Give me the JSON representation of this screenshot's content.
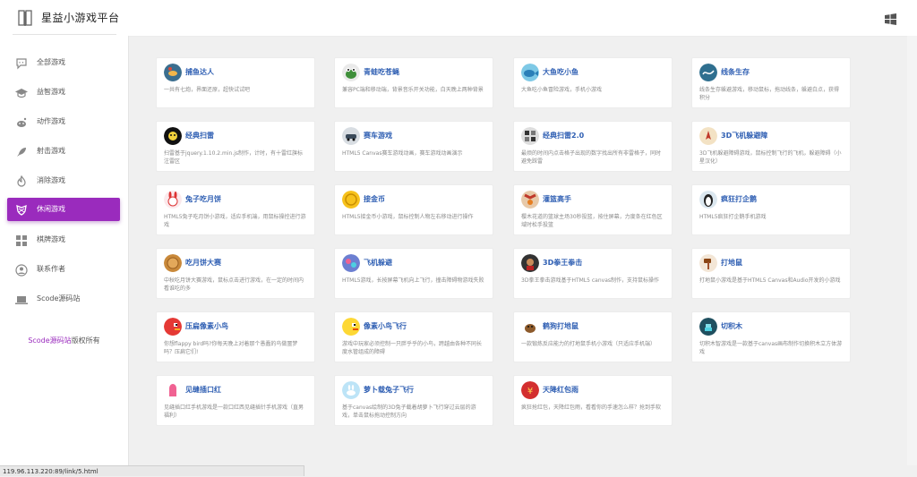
{
  "header": {
    "brand": "星益小游戏平台",
    "logo_icon": "book-logo-icon",
    "windows_icon": "windows-logo-icon"
  },
  "sidebar": {
    "accent_color": "#9a2bbd",
    "items": [
      {
        "label": "全部游戏",
        "icon": "chat-bubble-icon"
      },
      {
        "label": "益智游戏",
        "icon": "graduation-cap-icon"
      },
      {
        "label": "动作游戏",
        "icon": "reddit-icon"
      },
      {
        "label": "射击游戏",
        "icon": "rocket-icon"
      },
      {
        "label": "消除游戏",
        "icon": "fire-icon"
      },
      {
        "label": "休闲游戏",
        "icon": "shield-icon"
      },
      {
        "label": "棋牌游戏",
        "icon": "grid-icon"
      },
      {
        "label": "联系作者",
        "icon": "user-icon"
      },
      {
        "label": "Scode源码站",
        "icon": "laptop-icon"
      }
    ],
    "active_index": 5,
    "copyright_link": "Scode源码站",
    "copyright_suffix": "版权所有"
  },
  "games": [
    {
      "title": "捕鱼达人",
      "desc": "一共有七炮，界面还原，超快试试吧"
    },
    {
      "title": "青蛙吃苍蝇",
      "desc": "兼容PC端和移动端，背景音乐开关功能，白天晚上两种背景"
    },
    {
      "title": "大鱼吃小鱼",
      "desc": "大鱼吃小鱼冒险游戏，手机小游戏"
    },
    {
      "title": "线条生存",
      "desc": "线条生存躲避游戏，移动鼠标，拖动线条，躲避白点，获得积分"
    },
    {
      "title": "经典扫雷",
      "desc": "扫雷基于jquery.1.10.2.min.js制作，计时，有十雷红旗标注雷区"
    },
    {
      "title": "赛车游戏",
      "desc": "HTML5 Canvas赛车游戏动画，赛车游戏动画演示"
    },
    {
      "title": "经典扫雷2.0",
      "desc": "最烦的时间内点击格子出现的数字找出所有非雷格子，同时避免踩雷"
    },
    {
      "title": "3D飞机躲避障",
      "desc": "3D飞机躲避障碍游戏，鼠标控制飞行的飞机，躲避障碍（小星汉化）"
    },
    {
      "title": "兔子吃月饼",
      "desc": "HTML5兔子吃月饼小游戏，适应手机端，用鼠标操控进行游戏"
    },
    {
      "title": "接金币",
      "desc": "HTML5接金币小游戏，鼠标控制人物左右移动进行操作"
    },
    {
      "title": "灌篮高手",
      "desc": "樱木花道的篮球主场30秒投篮，按住屏幕，力度条在红色区域时松手投篮"
    },
    {
      "title": "疯狂打企鹅",
      "desc": "HTML5疯狂打企鹅手机游戏"
    },
    {
      "title": "吃月饼大赛",
      "desc": "中秋吃月饼大赛游戏，鼠标点击进行游戏，在一定的时间内看谁吃的多"
    },
    {
      "title": "飞机躲避",
      "desc": "HTML5游戏，长按屏幕飞机向上飞行，撞击障碍物游戏失败"
    },
    {
      "title": "3D拳王拳击",
      "desc": "3D拳王拳击游戏基于HTML5 canvas制作，支持鼠标操作"
    },
    {
      "title": "打地鼠",
      "desc": "打地鼠小游戏是基于HTML5 Canvas和Audio开发的小游戏"
    },
    {
      "title": "压扁像素小鸟",
      "desc": "你想flappy bird吗?你每天晚上对着那个愚蠢的鸟做噩梦吗？压扁它们!"
    },
    {
      "title": "像素小鸟飞行",
      "desc": "游戏中玩家必须控制一只胖乎乎的小鸟，跨越由各种不同长度水管组成的障碍"
    },
    {
      "title": "鹤狗打地鼠",
      "desc": "一款锻炼反应能力的打地鼠手机小游戏（只适应手机端）"
    },
    {
      "title": "切积木",
      "desc": "切积木智游戏是一款基于canvas画布制作切换积木立方体游戏"
    },
    {
      "title": "见缝插口红",
      "desc": "见缝插口红手机游戏是一款口红西见缝插针手机游戏（直男福利）"
    },
    {
      "title": "萝卜载兔子飞行",
      "desc": "基于canvas绘制的3D兔子载着胡萝卜飞行穿过云层的游戏，单击鼠标拖动控制方向"
    },
    {
      "title": "天降红包雨",
      "desc": "疯狂抢红包，天降红包雨，看看你的手速怎么样？抢到手软"
    }
  ],
  "status_bar": {
    "url": "119.96.113.220:89/link/5.html"
  }
}
